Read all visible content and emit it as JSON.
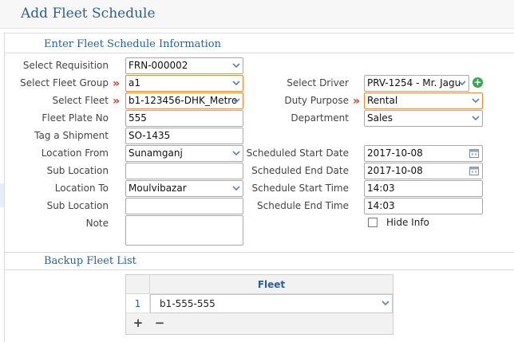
{
  "page": {
    "title": "Add Fleet Schedule"
  },
  "sections": {
    "info_title": "Enter Fleet Schedule Information",
    "backup_title": "Backup Fleet List"
  },
  "form": {
    "requisition": {
      "label": "Select Requisition",
      "value": "FRN-000002"
    },
    "fleet_group": {
      "label": "Select Fleet Group",
      "value": "a1"
    },
    "fleet": {
      "label": "Select Fleet",
      "value": "b1-123456-DHK_Metro"
    },
    "plate_no": {
      "label": "Fleet Plate No",
      "value": "555"
    },
    "shipment": {
      "label": "Tag a Shipment",
      "value": "SO-1435"
    },
    "location_from": {
      "label": "Location From",
      "value": "Sunamganj"
    },
    "sub_location_from": {
      "label": "Sub Location",
      "value": ""
    },
    "location_to": {
      "label": "Location To",
      "value": "Moulvibazar"
    },
    "sub_location_to": {
      "label": "Sub Location",
      "value": ""
    },
    "note": {
      "label": "Note",
      "value": ""
    },
    "driver": {
      "label": "Select Driver",
      "value": "PRV-1254 - Mr. Jagu"
    },
    "duty_purpose": {
      "label": "Duty Purpose",
      "value": "Rental"
    },
    "department": {
      "label": "Department",
      "value": "Sales"
    },
    "start_date": {
      "label": "Scheduled Start Date",
      "value": "2017-10-08"
    },
    "end_date": {
      "label": "Scheduled End Date",
      "value": "2017-10-08"
    },
    "start_time": {
      "label": "Schedule Start Time",
      "value": "14:03"
    },
    "end_time": {
      "label": "Schedule End Time",
      "value": "14:03"
    },
    "hide_info": {
      "label": "Hide Info",
      "checked": false
    },
    "required_mark": "»"
  },
  "backup_grid": {
    "column_header": "Fleet",
    "rows": [
      {
        "num": "1",
        "fleet": "b1-555-555"
      }
    ],
    "add_label": "+",
    "remove_label": "−"
  },
  "icons": {
    "add_driver": "plus-circle-icon",
    "dropdown": "chevron-down-icon",
    "calendar": "calendar-icon"
  },
  "colors": {
    "accent": "#2a5f9e",
    "required": "#d0392b",
    "required_border": "#e8883a",
    "add_green": "#2fa84f"
  }
}
